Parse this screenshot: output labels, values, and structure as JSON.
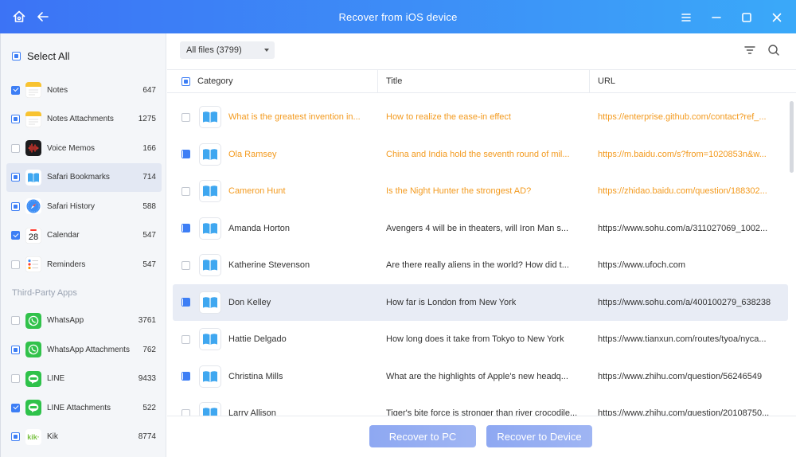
{
  "window": {
    "title": "Recover from iOS device"
  },
  "sidebar": {
    "select_all": "Select All",
    "section_third_party": "Third-Party Apps",
    "items": [
      {
        "label": "Notes",
        "count": "647",
        "icon": "notes-icon",
        "state": "checked"
      },
      {
        "label": "Notes Attachments",
        "count": "1275",
        "icon": "notes-icon",
        "state": "partial"
      },
      {
        "label": "Voice Memos",
        "count": "166",
        "icon": "voice-memos-icon",
        "state": "unchecked"
      },
      {
        "label": "Safari Bookmarks",
        "count": "714",
        "icon": "book-icon",
        "state": "partial",
        "active": true
      },
      {
        "label": "Safari History",
        "count": "588",
        "icon": "compass-icon",
        "state": "partial"
      },
      {
        "label": "Calendar",
        "count": "547",
        "icon": "calendar-icon",
        "state": "checked",
        "calendar_day": "28"
      },
      {
        "label": "Reminders",
        "count": "547",
        "icon": "reminders-icon",
        "state": "unchecked"
      }
    ],
    "third_party_items": [
      {
        "label": "WhatsApp",
        "count": "3761",
        "icon": "whatsapp-icon",
        "state": "unchecked"
      },
      {
        "label": "WhatsApp Attachments",
        "count": "762",
        "icon": "whatsapp-icon",
        "state": "partial"
      },
      {
        "label": "LINE",
        "count": "9433",
        "icon": "line-icon",
        "state": "unchecked"
      },
      {
        "label": "LINE Attachments",
        "count": "522",
        "icon": "line-icon",
        "state": "checked"
      },
      {
        "label": "Kik",
        "count": "8774",
        "icon": "kik-icon",
        "state": "partial",
        "logo_text": "kik·"
      }
    ]
  },
  "toolbar": {
    "filter_value": "All files (3799)"
  },
  "table": {
    "columns": [
      "Category",
      "Title",
      "URL"
    ],
    "rows": [
      {
        "category": "What is the greatest invention in...",
        "title": "How to realize the ease-in effect",
        "url": "https://enterprise.github.com/contact?ref_...",
        "checked": false,
        "style": "orange"
      },
      {
        "category": "Ola Ramsey",
        "title": "China and India hold the seventh round of mil...",
        "url": "https://m.baidu.com/s?from=1020853n&w...",
        "checked": true,
        "style": "orange"
      },
      {
        "category": "Cameron Hunt",
        "title": "Is the Night Hunter the strongest AD?",
        "url": "https://zhidao.baidu.com/question/188302...",
        "checked": false,
        "style": "orange"
      },
      {
        "category": "Amanda Horton",
        "title": "Avengers 4 will be in theaters, will Iron Man s...",
        "url": "https://www.sohu.com/a/311027069_1002...",
        "checked": true,
        "style": "normal"
      },
      {
        "category": "Katherine Stevenson",
        "title": "Are there really aliens in the world? How did t...",
        "url": "https://www.ufoch.com",
        "checked": false,
        "style": "normal"
      },
      {
        "category": "Don Kelley",
        "title": "How far is London from New York",
        "url": "https://www.sohu.com/a/400100279_638238",
        "checked": true,
        "style": "normal",
        "selected": true
      },
      {
        "category": "Hattie Delgado",
        "title": "How long does it take from Tokyo to New York",
        "url": "https://www.tianxun.com/routes/tyoa/nyca...",
        "checked": false,
        "style": "normal"
      },
      {
        "category": "Christina Mills",
        "title": "What are the highlights of Apple's new headq...",
        "url": "https://www.zhihu.com/question/56246549",
        "checked": true,
        "style": "normal"
      },
      {
        "category": "Larry Allison",
        "title": "Tiger's bite force is stronger than river crocodile...",
        "url": "https://www.zhihu.com/question/20108750...",
        "checked": false,
        "style": "normal"
      }
    ]
  },
  "footer": {
    "recover_pc": "Recover to PC",
    "recover_device": "Recover to Device"
  },
  "colors": {
    "accent": "#3d7ef5",
    "orange_text": "#f39a1e",
    "button": "#93adf2"
  }
}
